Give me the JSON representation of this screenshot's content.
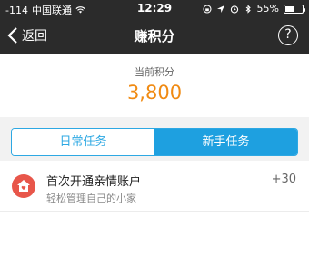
{
  "status_bar": {
    "signal": "-114",
    "carrier": "中国联通",
    "time": "12:29",
    "battery_percent": "55%",
    "battery_level": 0.55
  },
  "navbar": {
    "back_label": "返回",
    "title": "赚积分",
    "help_label": "?"
  },
  "points": {
    "label": "当前积分",
    "value": "3,800"
  },
  "tabs": [
    {
      "label": "日常任务",
      "active": false
    },
    {
      "label": "新手任务",
      "active": true
    }
  ],
  "tasks": [
    {
      "icon": "home-heart-icon",
      "title": "首次开通亲情账户",
      "subtitle": "轻松管理自己的小家",
      "reward": "+30"
    }
  ],
  "colors": {
    "accent": "#1ea0e0",
    "points": "#f08a12",
    "task_icon_bg": "#e8564a",
    "header_bg": "#2b2b2b"
  }
}
